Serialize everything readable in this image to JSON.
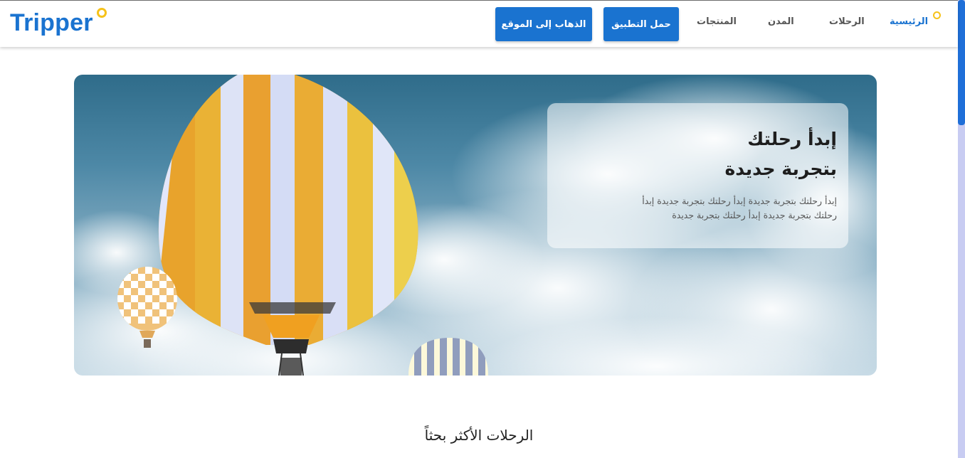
{
  "brand": {
    "name": "Tripper"
  },
  "header": {
    "buttons": {
      "go_to_site": "الذهاب إلى الموقع",
      "download_app": "حمل التطبيق"
    },
    "nav": {
      "home": "الرئيسية",
      "trips": "الرحلات",
      "cities": "المدن",
      "products": "المنتجات"
    }
  },
  "hero": {
    "title_line1": "إبدأ رحلتك",
    "title_line2": "بتجربة جديدة",
    "description": "إبدأ رحلتك بتجربة جديدة إبدأ رحلتك بتجربة جديدة إبدأ رحلتك بتجربة جديدة إبدأ رحلتك بتجربة جديدة"
  },
  "section": {
    "title": "الرحلات الأكثر بحثاً"
  },
  "colors": {
    "accent": "#1a73d0",
    "dot": "#f6c21a",
    "scroll_track": "#c8ccf2"
  }
}
